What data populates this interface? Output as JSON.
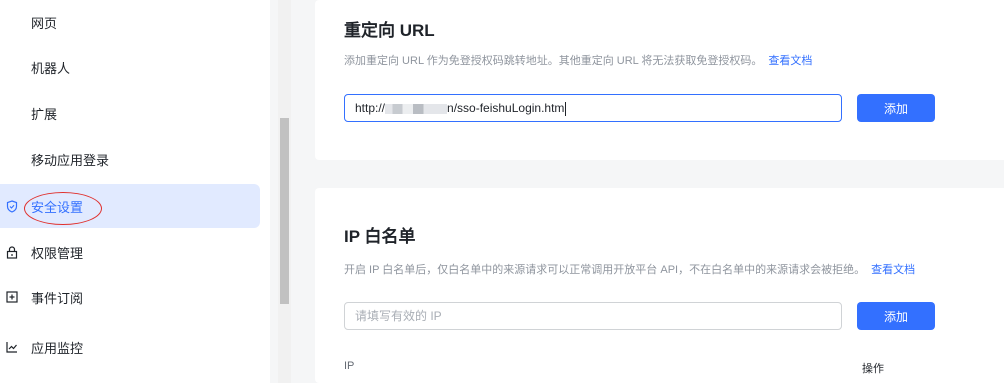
{
  "sidebar": {
    "items": [
      {
        "label": "网页",
        "icon": ""
      },
      {
        "label": "机器人",
        "icon": ""
      },
      {
        "label": "扩展",
        "icon": ""
      },
      {
        "label": "移动应用登录",
        "icon": ""
      },
      {
        "label": "安全设置",
        "icon": "shield-icon",
        "active": true
      },
      {
        "label": "权限管理",
        "icon": "lock-icon"
      },
      {
        "label": "事件订阅",
        "icon": "event-icon"
      },
      {
        "label": "应用监控",
        "icon": "chart-line-icon"
      }
    ]
  },
  "redirect": {
    "title": "重定向 URL",
    "description": "添加重定向 URL 作为免登授权码跳转地址。其他重定向 URL 将无法获取免登授权码。",
    "doc_link": "查看文档",
    "input_prefix": "http://",
    "input_suffix": "n/sso-feishuLogin.htm",
    "add_button": "添加"
  },
  "ip_whitelist": {
    "title": "IP 白名单",
    "description": "开启 IP 白名单后，仅白名单中的来源请求可以正常调用开放平台 API，不在白名单中的来源请求会被拒绝。",
    "doc_link": "查看文档",
    "input_placeholder": "请填写有效的 IP",
    "add_button": "添加",
    "columns": [
      "IP",
      "操作"
    ]
  },
  "colors": {
    "accent": "#3370ff",
    "active_bg": "#e1eaff",
    "annotation": "#e0302d"
  }
}
